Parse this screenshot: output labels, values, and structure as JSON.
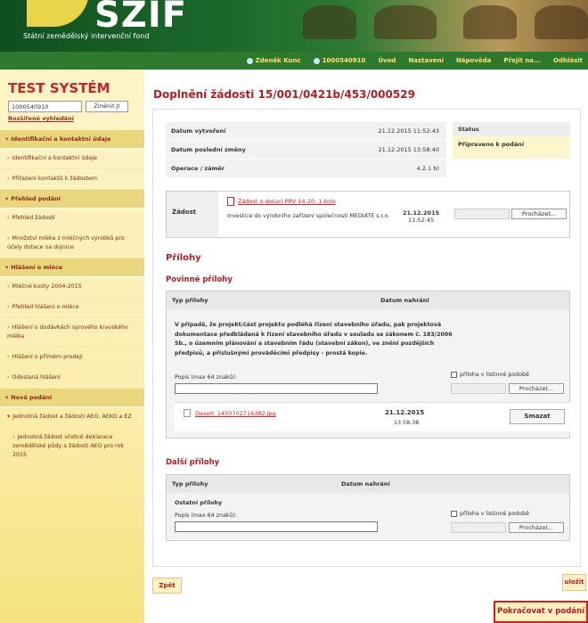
{
  "header": {
    "logo_text": "SZIF",
    "subtitle": "Státní zemědělský intervenční fond"
  },
  "topbar": {
    "user_name": "Zdeněk Kunc",
    "client_id": "1000540910",
    "links": [
      "Úvod",
      "Nastavení",
      "Nápověda",
      "Přejít na...",
      "Odhlásit"
    ]
  },
  "sidebar": {
    "system_title": "TEST SYSTÉM",
    "id_value": "1000540910",
    "change_button": "Změnit JI",
    "advanced_search": "Rozšířené vyhledání",
    "menu": [
      {
        "type": "section",
        "label": "Identifikační a kontaktní údaje"
      },
      {
        "type": "item",
        "label": "Identifikační a kontaktní údaje"
      },
      {
        "type": "item",
        "label": "Přiřazení kontaktů k žádostem"
      },
      {
        "type": "section",
        "label": "Přehled podání"
      },
      {
        "type": "item",
        "label": "Přehled žádostí"
      },
      {
        "type": "item",
        "label": "Množství mléka z mléčných výrobků pro účely dotace na dojnice"
      },
      {
        "type": "section",
        "label": "Hlášení o mléce"
      },
      {
        "type": "item",
        "label": "Mléčné kvóty 2004-2015"
      },
      {
        "type": "item",
        "label": "Přehled hlášení o mléce"
      },
      {
        "type": "item",
        "label": "Hlášení o dodávkách syrového kravského mléka"
      },
      {
        "type": "item",
        "label": "Hlášení o přímém prodeji"
      },
      {
        "type": "item",
        "label": "Odeslaná hlášení"
      },
      {
        "type": "section",
        "label": "Nová podání"
      },
      {
        "type": "item",
        "label": "Jednotná žádost a žádosti AEO, AEKO a EZ"
      },
      {
        "type": "subitem",
        "label": "Jednotná žádost včetně deklarace zemědělské půdy a žádosti AEO pro rok 2015"
      }
    ]
  },
  "main": {
    "page_title": "Doplnění žádosti 15/001/0421b/453/000529",
    "info": [
      {
        "label": "Datum vytvoření",
        "value": "21.12.2015 11:52:43"
      },
      {
        "label": "Datum poslední změny",
        "value": "21.12.2015 13:58:40"
      },
      {
        "label": "Operace / záměr",
        "value": "4.2.1 b)"
      }
    ],
    "status_header": "Status",
    "status_value": "Připraveno k podání",
    "request": {
      "label": "Žádost",
      "file_link": "Žádost o dotaci PRV 14-20, 1.kolo",
      "description": "Investice do výrobního zařízení společnosti MEDIATE s.r.o.",
      "date": "21.12.2015",
      "time": "11:52:45",
      "browse": "Procházet..."
    },
    "attachments_title": "Přílohy",
    "mandatory_title": "Povinné přílohy",
    "col_type": "Typ přílohy",
    "col_date": "Datum nahrání",
    "note": "V případě, že projekt/část projektu podléhá řízení stavebního úřadu, pak projektová dokumentace předkládaná k řízení stavebního úřadu v souladu se zákonem č. 183/2006 Sb., o územním plánování a stavebním řádu (stavební zákon), ve znění pozdějších předpisů, a příslušnými prováděcími předpisy - prostá kopie.",
    "desc_label": "Popis (max 64 znaků):",
    "paper_label": "příloha v listinné podobě",
    "browse": "Procházet...",
    "file_name": "Desert_1450702716382.jpg",
    "file_date": "21.12.2015",
    "file_time": "13:58:38",
    "delete": "Smazat",
    "other_title": "Další přílohy",
    "other_type": "Ostatní přílohy",
    "save": "uložit",
    "back": "Zpět",
    "continue": "Pokračovat v podání"
  }
}
